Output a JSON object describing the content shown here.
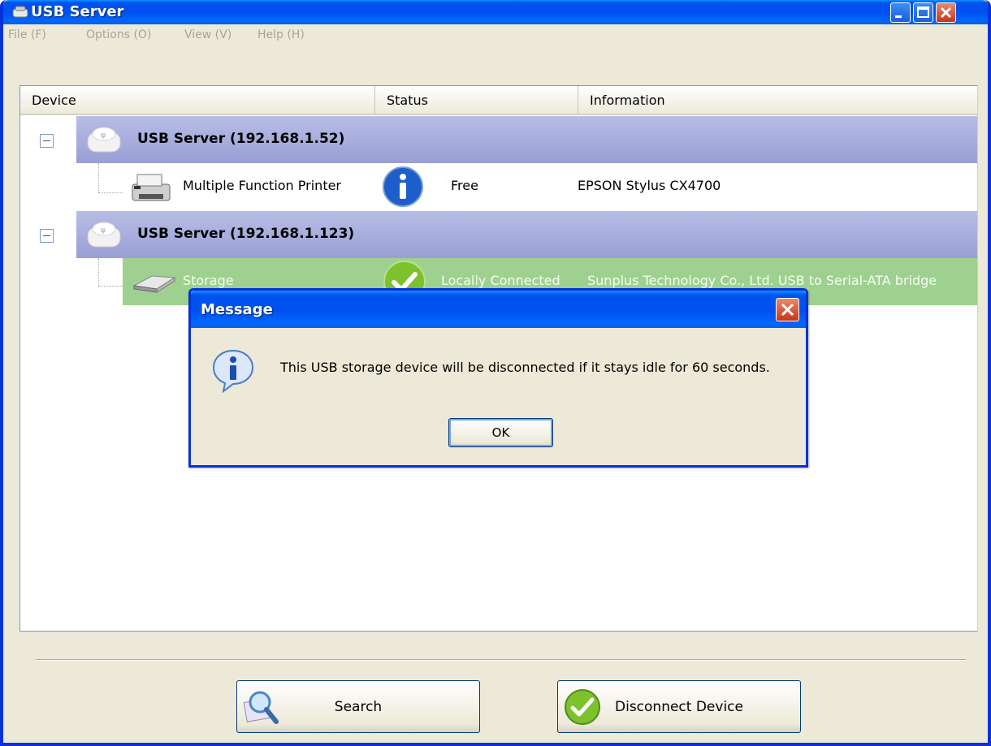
{
  "window": {
    "title": "USB Server",
    "accent_color": "#0050ee",
    "icons": {
      "app": "usb-server-icon",
      "minimize": "minimize-icon",
      "maximize": "maximize-icon",
      "close": "close-icon"
    }
  },
  "menubar": {
    "items": [
      "File (F)",
      "Options (O)",
      "View (V)",
      "Help (H)"
    ]
  },
  "table": {
    "columns": [
      "Device",
      "Status",
      "Information"
    ],
    "servers": [
      {
        "label": "USB Server  (192.168.1.52)",
        "devices": [
          {
            "name": "Multiple Function Printer",
            "status": "Free",
            "information": "EPSON Stylus CX4700",
            "icon": "printer-icon",
            "status_icon": "info-icon"
          }
        ]
      },
      {
        "label": "USB Server  (192.168.1.123)",
        "devices": [
          {
            "name": "Storage",
            "status": "Locally Connected",
            "information": "Sunplus Technology Co., Ltd. USB to Serial-ATA bridge",
            "icon": "drive-icon",
            "status_icon": "check-icon",
            "selected": true,
            "highlight_color": "#9ed18f"
          }
        ]
      }
    ],
    "server_row_color": "#a8aedd"
  },
  "buttons": {
    "search": {
      "label": "Search",
      "icon": "magnifier-icon"
    },
    "disconnect": {
      "label": "Disconnect Device",
      "icon": "check-circle-icon"
    }
  },
  "dialog": {
    "title": "Message",
    "message": "This USB storage device will be disconnected if it stays idle for 60 seconds.",
    "ok_label": "OK",
    "icon": "info-bubble-icon"
  }
}
